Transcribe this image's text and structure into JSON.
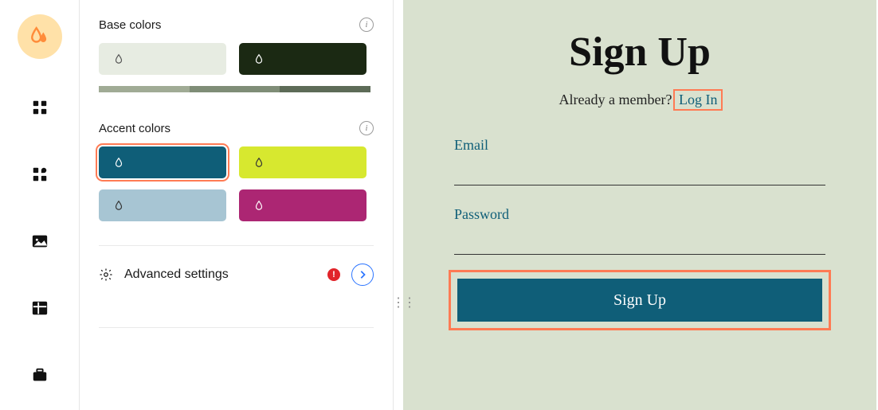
{
  "nav": {
    "active_logo": "colors"
  },
  "settings": {
    "base_title": "Base colors",
    "accent_title": "Accent colors",
    "advanced_label": "Advanced settings",
    "base_swatches": [
      {
        "bg": "#e7ece2",
        "icon": "#555"
      },
      {
        "bg": "#1b2913",
        "icon": "#fff"
      }
    ],
    "gradient": [
      "#a0ab95",
      "#7f8d77",
      "#5d6b57"
    ],
    "accent_swatches": [
      {
        "bg": "#0f5e78",
        "icon": "#fff",
        "selected": true
      },
      {
        "bg": "#d7e82f",
        "icon": "#333",
        "selected": false
      },
      {
        "bg": "#a7c5d3",
        "icon": "#333",
        "selected": false
      },
      {
        "bg": "#ac2673",
        "icon": "#fff",
        "selected": false
      }
    ]
  },
  "preview": {
    "title": "Sign Up",
    "prompt_text": "Already a member?",
    "login_link": "Log In",
    "email_label": "Email",
    "password_label": "Password",
    "button_label": "Sign Up"
  }
}
